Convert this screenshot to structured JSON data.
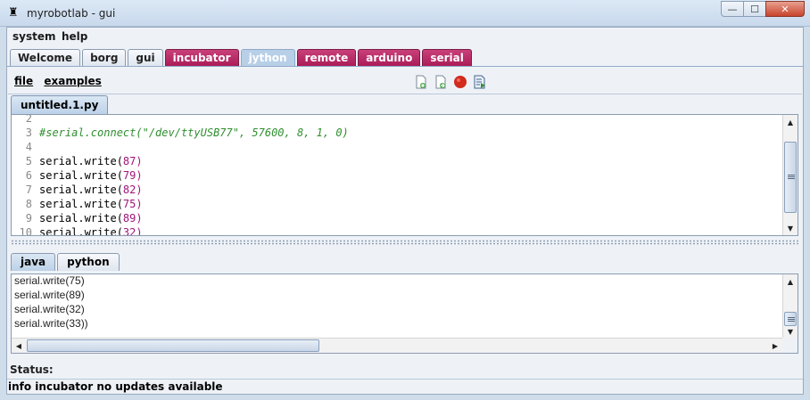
{
  "window": {
    "title": "myrobotlab - gui"
  },
  "menubar": {
    "items": [
      "system",
      "help"
    ]
  },
  "tabs": [
    {
      "label": "Welcome",
      "style": "plain"
    },
    {
      "label": "borg",
      "style": "plain"
    },
    {
      "label": "gui",
      "style": "plain"
    },
    {
      "label": "incubator",
      "style": "service"
    },
    {
      "label": "jython",
      "style": "active"
    },
    {
      "label": "remote",
      "style": "service"
    },
    {
      "label": "arduino",
      "style": "service"
    },
    {
      "label": "serial",
      "style": "service"
    }
  ],
  "jython": {
    "menu": [
      "file",
      "examples"
    ],
    "toolbar": [
      "new-file-icon",
      "open-file-icon",
      "stop-record-icon",
      "execute-icon"
    ],
    "file_tab": "untitled.1.py",
    "lines": [
      {
        "n": "2",
        "text": ""
      },
      {
        "n": "3",
        "text": "#serial.connect(\"/dev/ttyUSB77\", 57600, 8, 1, 0)",
        "kind": "comment"
      },
      {
        "n": "4",
        "text": ""
      },
      {
        "n": "5",
        "text": "serial.write(",
        "arg": "87"
      },
      {
        "n": "6",
        "text": "serial.write(",
        "arg": "79"
      },
      {
        "n": "7",
        "text": "serial.write(",
        "arg": "82"
      },
      {
        "n": "8",
        "text": "serial.write(",
        "arg": "75"
      },
      {
        "n": "9",
        "text": "serial.write(",
        "arg": "89"
      },
      {
        "n": "10",
        "text": "serial.write(",
        "arg": "32"
      }
    ],
    "output_tabs": [
      "java",
      "python"
    ],
    "output": [
      "serial.write(75)",
      "serial.write(89)",
      "serial.write(32)",
      "serial.write(33))"
    ]
  },
  "status": {
    "label": "Status:",
    "info": "info incubator no updates available"
  },
  "colors": {
    "service_tab": "#b02060",
    "active_tab": "#b8cfe8",
    "comment": "#2f8f2f",
    "number": "#a0147a"
  }
}
